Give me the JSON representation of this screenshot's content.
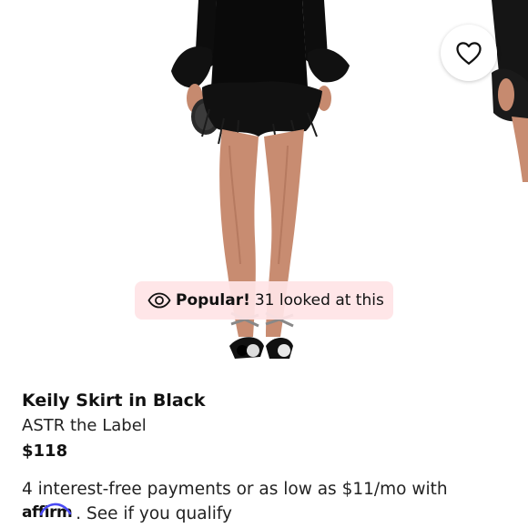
{
  "gallery": {
    "main_image_alt": "",
    "favorite_icon": "heart-icon",
    "popular_icon": "eye-icon",
    "popular_label": "Popular!",
    "popular_text": "31 looked at this"
  },
  "product": {
    "title": "Keily Skirt in Black",
    "brand": "ASTR the Label",
    "price": "$118"
  },
  "financing": {
    "line1": "4 interest-free payments or as low as $11/mo with",
    "logo_text": "affirm",
    "link_text": ". See if you qualify"
  },
  "colors": {
    "badge_bg": "#ffe4e6",
    "affirm_blue": "#4a4af4"
  }
}
